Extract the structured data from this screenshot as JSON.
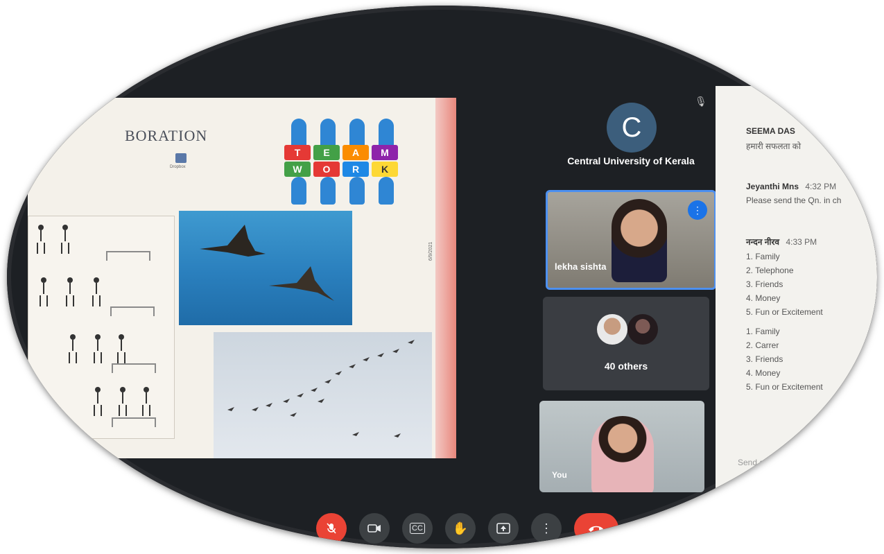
{
  "slide": {
    "title": "BORATION",
    "dropbox_label": "Dropbox",
    "date": "6/9/2021",
    "puzzle_letters": [
      "T",
      "E",
      "A",
      "M",
      "W",
      "O",
      "R",
      "K"
    ]
  },
  "participants": {
    "host": {
      "initial": "C",
      "name": "Central University of Kerala"
    },
    "speaker": {
      "name": "lekha sishta"
    },
    "others": {
      "label": "40 others"
    },
    "self": {
      "label": "You"
    }
  },
  "chat": {
    "messages": [
      {
        "sender": "SEEMA DAS",
        "time": "",
        "lines": [
          "हमारी सफलता को"
        ]
      },
      {
        "sender": "Jeyanthi Mns",
        "time": "4:32 PM",
        "lines": [
          "Please send the Qn. in ch"
        ]
      },
      {
        "sender": "नन्दन नीरव",
        "time": "4:33 PM",
        "lines": [
          "1. Family",
          "2. Telephone",
          "3. Friends",
          "4. Money",
          "5. Fun or Excitement",
          "1. Family",
          "2. Carrer",
          "3. Friends",
          "4. Money",
          "5. Fun or Excitement"
        ]
      }
    ],
    "input_placeholder": "Send a"
  },
  "controls": {
    "mic": "mic-off",
    "camera": "camera",
    "captions": "CC",
    "raise_hand": "hand",
    "present": "present",
    "more": "more",
    "end_call": "end-call"
  },
  "colors": {
    "call_background": "#1d2024",
    "accent_blue": "#1a73e8",
    "danger_red": "#ea4335"
  }
}
